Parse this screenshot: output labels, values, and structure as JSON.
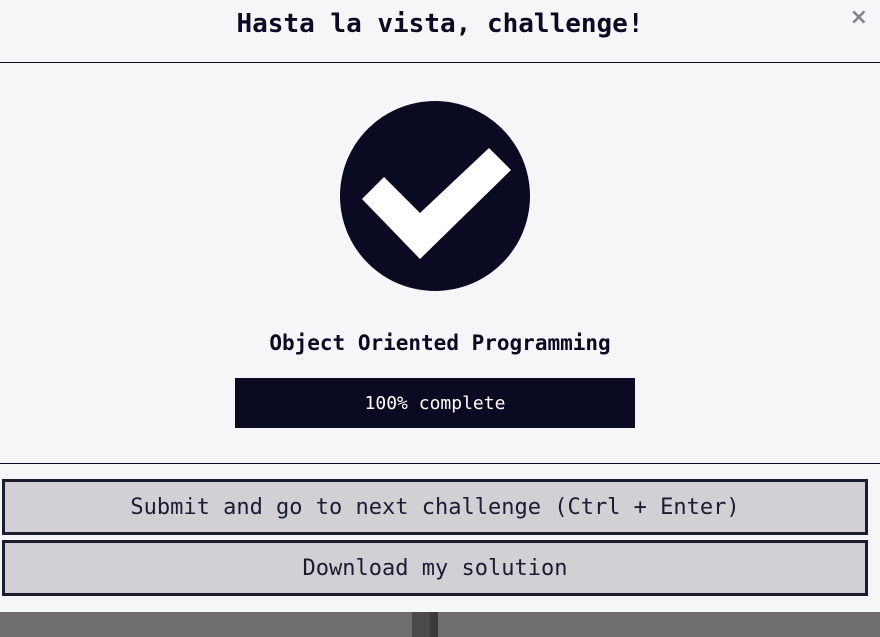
{
  "modal": {
    "title": "Hasta la vista, challenge!",
    "close_symbol": "×",
    "close_icon": "close-icon"
  },
  "completion": {
    "icon": "check-circle-icon",
    "challenge_name": "Object Oriented Programming",
    "progress_percent": 100,
    "progress_label": "100% complete"
  },
  "actions": {
    "submit_label": "Submit and go to next challenge (Ctrl + Enter)",
    "download_label": "Download my solution"
  },
  "colors": {
    "dark": "#0a0a23",
    "panel": "#f5f6f7",
    "button_bg": "#d0d0d5"
  }
}
